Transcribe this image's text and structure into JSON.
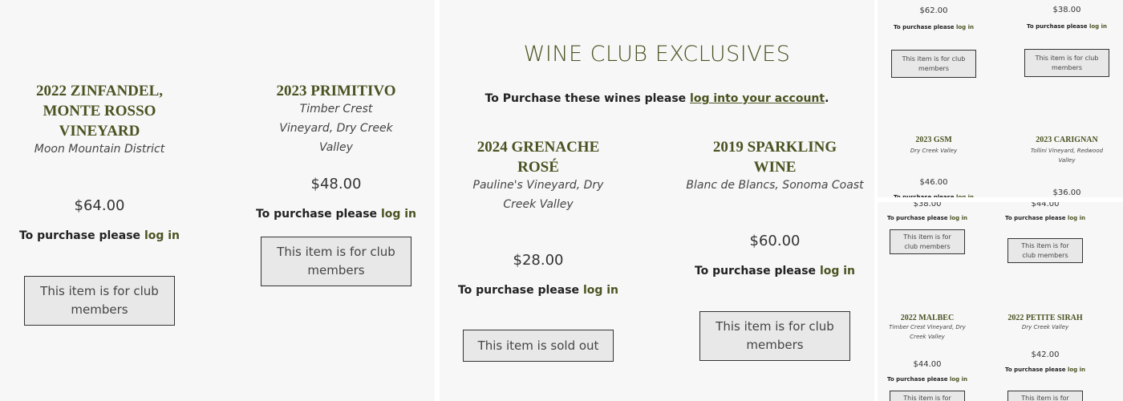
{
  "club": {
    "title": "WINE CLUB EXCLUSIVES",
    "intro_prefix": "To Purchase these wines please ",
    "intro_link": "log into your account",
    "intro_suffix": "."
  },
  "common": {
    "purchase_prefix": "To purchase please ",
    "login_link": "log in",
    "club_members_label": "This item is for club members",
    "sold_out_label": "This item is sold out"
  },
  "left": [
    {
      "name": "2022 ZINFANDEL, MONTE ROSSO VINEYARD",
      "sub": "Moon Mountain District",
      "price": "$64.00"
    },
    {
      "name": "2023 PRIMITIVO",
      "sub": "Timber Crest Vineyard, Dry Creek Valley",
      "price": "$48.00"
    }
  ],
  "mid": [
    {
      "name": "2024 GRENACHE ROSÉ",
      "sub": "Pauline's Vineyard, Dry Creek Valley",
      "price": "$28.00"
    },
    {
      "name": "2019 SPARKLING WINE",
      "sub": "Blanc de Blancs, Sonoma Coast",
      "price": "$60.00"
    }
  ],
  "top_right": {
    "top_prices": [
      "$62.00",
      "$38.00"
    ],
    "wines": [
      {
        "name": "2023 GSM",
        "sub": "Dry Creek Valley",
        "price": "$46.00"
      },
      {
        "name": "2023 CARIGNAN",
        "sub": "Tollini Vineyard, Redwood Valley",
        "price": "$36.00"
      }
    ]
  },
  "bottom_right": {
    "top_prices": [
      "$38.00",
      "$44.00"
    ],
    "wines": [
      {
        "name": "2022 MALBEC",
        "sub": "Timber Crest Vineyard, Dry Creek Valley",
        "price": "$44.00"
      },
      {
        "name": "2022 PETITE SIRAH",
        "sub": "Dry Creek Valley",
        "price": "$42.00"
      }
    ]
  }
}
